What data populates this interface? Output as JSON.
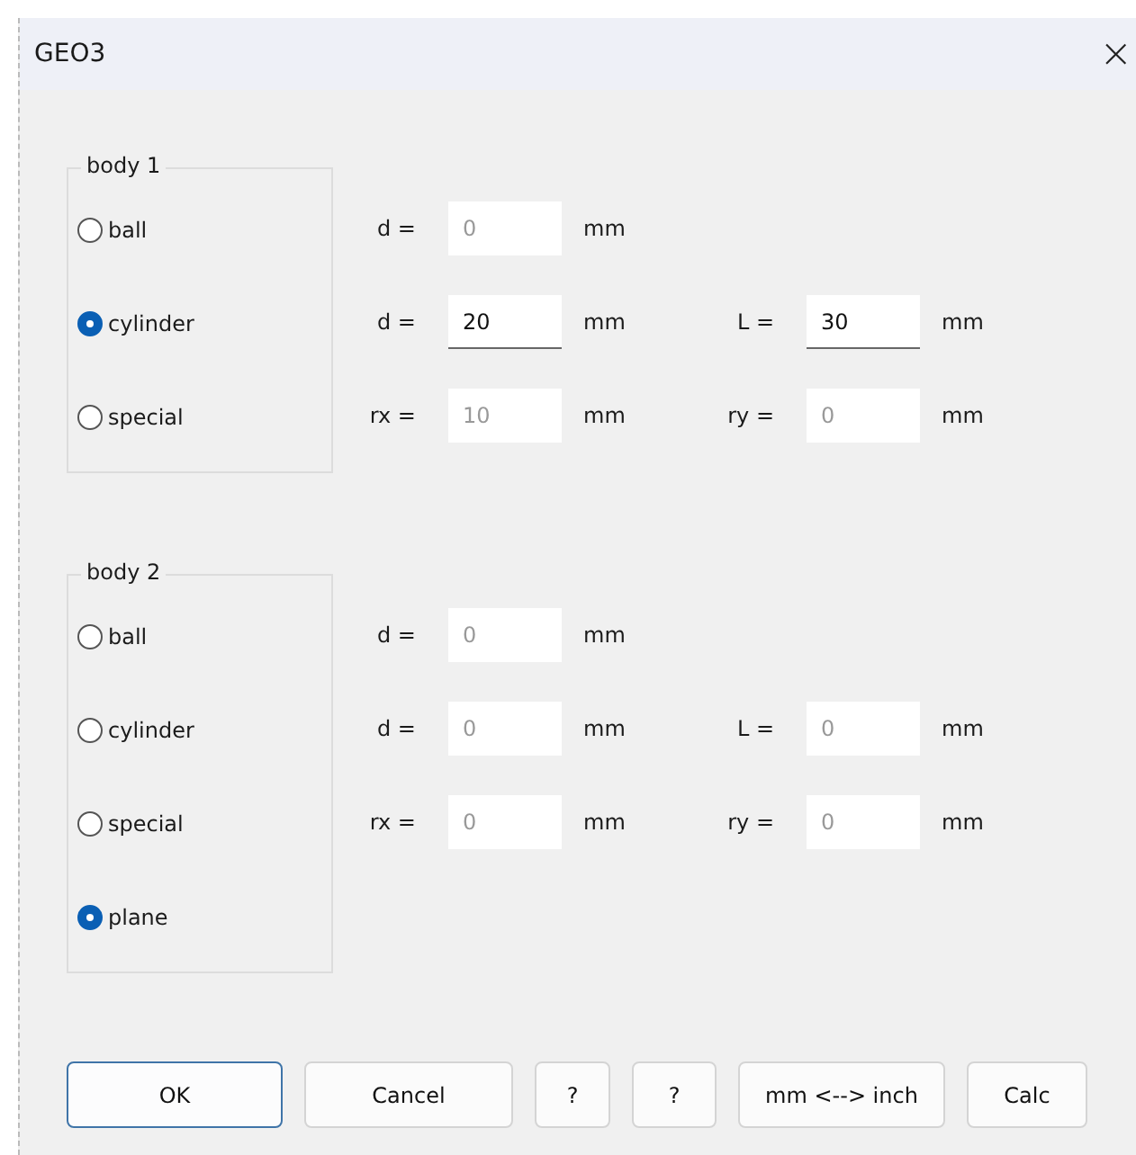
{
  "window": {
    "title": "GEO3",
    "close": "×"
  },
  "bodies": [
    {
      "legend": "body 1",
      "options": [
        {
          "label": "ball",
          "selected": false,
          "fields": [
            {
              "label": "d =",
              "value": "0",
              "unit": "mm",
              "disabled": true
            }
          ]
        },
        {
          "label": "cylinder",
          "selected": true,
          "fields": [
            {
              "label": "d =",
              "value": "20",
              "unit": "mm",
              "disabled": false
            },
            {
              "label": "L =",
              "value": "30",
              "unit": "mm",
              "disabled": false
            }
          ]
        },
        {
          "label": "special",
          "selected": false,
          "fields": [
            {
              "label": "rx =",
              "value": "10",
              "unit": "mm",
              "disabled": true
            },
            {
              "label": "ry =",
              "value": "0",
              "unit": "mm",
              "disabled": true
            }
          ]
        }
      ]
    },
    {
      "legend": "body 2",
      "options": [
        {
          "label": "ball",
          "selected": false,
          "fields": [
            {
              "label": "d =",
              "value": "0",
              "unit": "mm",
              "disabled": true
            }
          ]
        },
        {
          "label": "cylinder",
          "selected": false,
          "fields": [
            {
              "label": "d =",
              "value": "0",
              "unit": "mm",
              "disabled": true
            },
            {
              "label": "L =",
              "value": "0",
              "unit": "mm",
              "disabled": true
            }
          ]
        },
        {
          "label": "special",
          "selected": false,
          "fields": [
            {
              "label": "rx =",
              "value": "0",
              "unit": "mm",
              "disabled": true
            },
            {
              "label": "ry =",
              "value": "0",
              "unit": "mm",
              "disabled": true
            }
          ]
        },
        {
          "label": "plane",
          "selected": true
        }
      ]
    }
  ],
  "buttons": [
    {
      "label": "OK",
      "default": true
    },
    {
      "label": "Cancel",
      "default": false
    },
    {
      "label": "?",
      "default": false
    },
    {
      "label": "?",
      "default": false
    },
    {
      "label": "mm <--> inch",
      "default": false
    },
    {
      "label": "Calc",
      "default": false
    }
  ]
}
